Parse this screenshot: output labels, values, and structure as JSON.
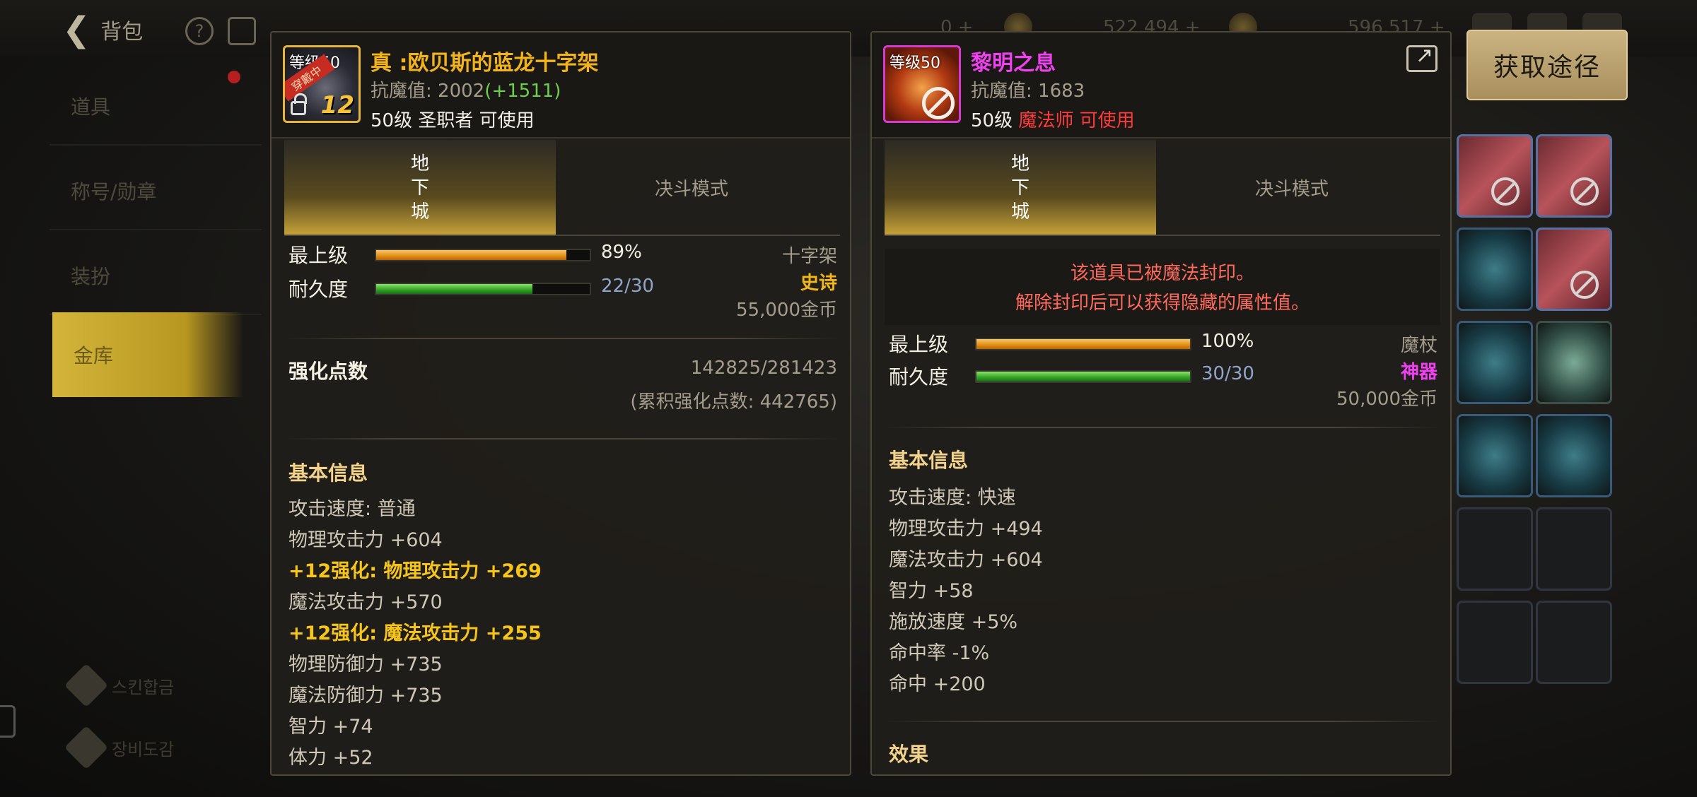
{
  "topbar": {
    "back_label": "背包",
    "help_glyph": "?",
    "currency_a": "522,494 +",
    "currency_b": "596,517 +",
    "left_num": "0 +"
  },
  "sidebar": {
    "items": [
      {
        "label": "道具"
      },
      {
        "label": "称号/勋章"
      },
      {
        "label": "装扮"
      },
      {
        "label": "金库"
      }
    ],
    "bottom": [
      {
        "label": "스킨합금"
      },
      {
        "label": "장비도감"
      }
    ]
  },
  "get_path_button": "获取途径",
  "colors": {
    "legendary_gold": "#f3b31b",
    "epic_pink": "#f041f0",
    "bonus_green": "#6ed04a",
    "warning_red": "#ff3b3b",
    "accent_button": "#cbb382"
  },
  "left_item": {
    "name": "真 :欧贝斯的蓝龙十字架",
    "icon_level": "等级50",
    "icon_ribbon": "穿戴中",
    "icon_reinforce": "12",
    "resist_label": "抗魔值: ",
    "resist_value": "2002",
    "resist_bonus": "(+1511)",
    "requirement": "50级 圣职者 可使用",
    "tabs": {
      "dungeon": [
        "地",
        "下",
        "城"
      ],
      "duel": "决斗模式"
    },
    "max_level_label": "最上级",
    "max_level_pct": 89,
    "max_level_text": "89%",
    "durability_label": "耐久度",
    "durability_current": 22,
    "durability_max": 30,
    "durability_text": "22/30",
    "type": "十字架",
    "rarity": "史诗",
    "price": "55,000金币",
    "reinforce_points_label": "强化点数",
    "reinforce_points": "142825/281423",
    "reinforce_total": "(累积强化点数: 442765)",
    "basic_info_title": "基本信息",
    "stats": [
      {
        "text": "攻击速度:  普通",
        "style": "normal"
      },
      {
        "text": "物理攻击力 +604",
        "style": "normal"
      },
      {
        "text": "+12强化:  物理攻击力 +269",
        "style": "gold"
      },
      {
        "text": "魔法攻击力 +570",
        "style": "normal"
      },
      {
        "text": "+12强化:  魔法攻击力 +255",
        "style": "gold"
      },
      {
        "text": "物理防御力 +735",
        "style": "normal"
      },
      {
        "text": "魔法防御力 +735",
        "style": "normal"
      },
      {
        "text": "智力 +74",
        "style": "normal"
      },
      {
        "text": "体力 +52",
        "style": "normal"
      }
    ]
  },
  "right_item": {
    "name": "黎明之息",
    "icon_level": "等级50",
    "resist_label": "抗魔值: ",
    "resist_value": "1683",
    "requirement_level": "50级 ",
    "requirement_class": "魔法师 可使用",
    "tabs": {
      "dungeon": [
        "地",
        "下",
        "城"
      ],
      "duel": "决斗模式"
    },
    "seal_line1": "该道具已被魔法封印。",
    "seal_line2": "解除封印后可以获得隐藏的属性值。",
    "max_level_label": "最上级",
    "max_level_pct": 100,
    "max_level_text": "100%",
    "durability_label": "耐久度",
    "durability_current": 30,
    "durability_max": 30,
    "durability_text": "30/30",
    "type": "魔杖",
    "rarity": "神器",
    "price": "50,000金币",
    "basic_info_title": "基本信息",
    "stats": [
      {
        "text": "攻击速度:  快速"
      },
      {
        "text": "物理攻击力 +494"
      },
      {
        "text": "魔法攻击力 +604"
      },
      {
        "text": "智力 +58"
      },
      {
        "text": "施放速度 +5%"
      },
      {
        "text": "命中率 -1%"
      },
      {
        "text": "命中 +200"
      }
    ],
    "effect_title": "效果"
  }
}
